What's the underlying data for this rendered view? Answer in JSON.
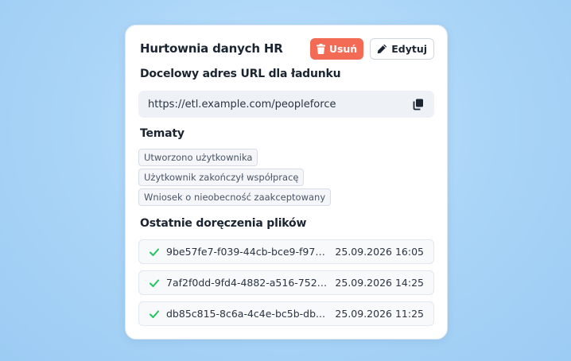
{
  "card": {
    "title": "Hurtownia danych HR",
    "delete_label": "Usuń",
    "edit_label": "Edytuj"
  },
  "url_section": {
    "title": "Docelowy adres URL dla ładunku",
    "url": "https://etl.example.com/peopleforce"
  },
  "topics": {
    "title": "Tematy",
    "items": [
      "Utworzono użytkownika",
      "Użytkownik zakończył współpracę",
      "Wniosek o nieobecność zaakceptowany"
    ]
  },
  "deliveries": {
    "title": "Ostatnie doręczenia plików",
    "items": [
      {
        "id": "9be57fe7-f039-44cb-bce9-f970...",
        "timestamp": "25.09.2026 16:05",
        "status": "success"
      },
      {
        "id": "7af2f0dd-9fd4-4882-a516-7521...",
        "timestamp": "25.09.2026 14:25",
        "status": "success"
      },
      {
        "id": "db85c815-8c6a-4c4e-bc5b-db...",
        "timestamp": "25.09.2026 11:25",
        "status": "success"
      }
    ]
  },
  "colors": {
    "delete": "#f36a55",
    "success": "#22c55e",
    "background": "#a9d4f7"
  }
}
